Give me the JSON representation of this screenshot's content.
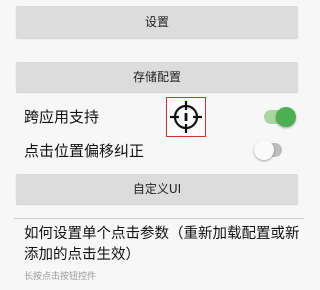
{
  "buttons": {
    "settings": "设置",
    "storage": "存储配置",
    "custom_ui": "自定义UI"
  },
  "toggles": {
    "cross_app_support": {
      "label": "跨应用支持",
      "on": true
    },
    "click_offset_correction": {
      "label": "点击位置偏移纠正",
      "on": false
    }
  },
  "help": {
    "title": "如何设置单个点击参数（重新加载配置或新添加的点击生效）",
    "subtitle": "长按点击按钮控件"
  },
  "icons": {
    "target": "crosshair-target-icon"
  },
  "colors": {
    "switch_on_knob": "#4caf50",
    "switch_on_track": "#a8d5a0",
    "switch_off_knob": "#fafafa",
    "switch_off_track": "#bdbdbd",
    "target_border": "#d0352b",
    "button_bg": "#dcdcdc"
  }
}
